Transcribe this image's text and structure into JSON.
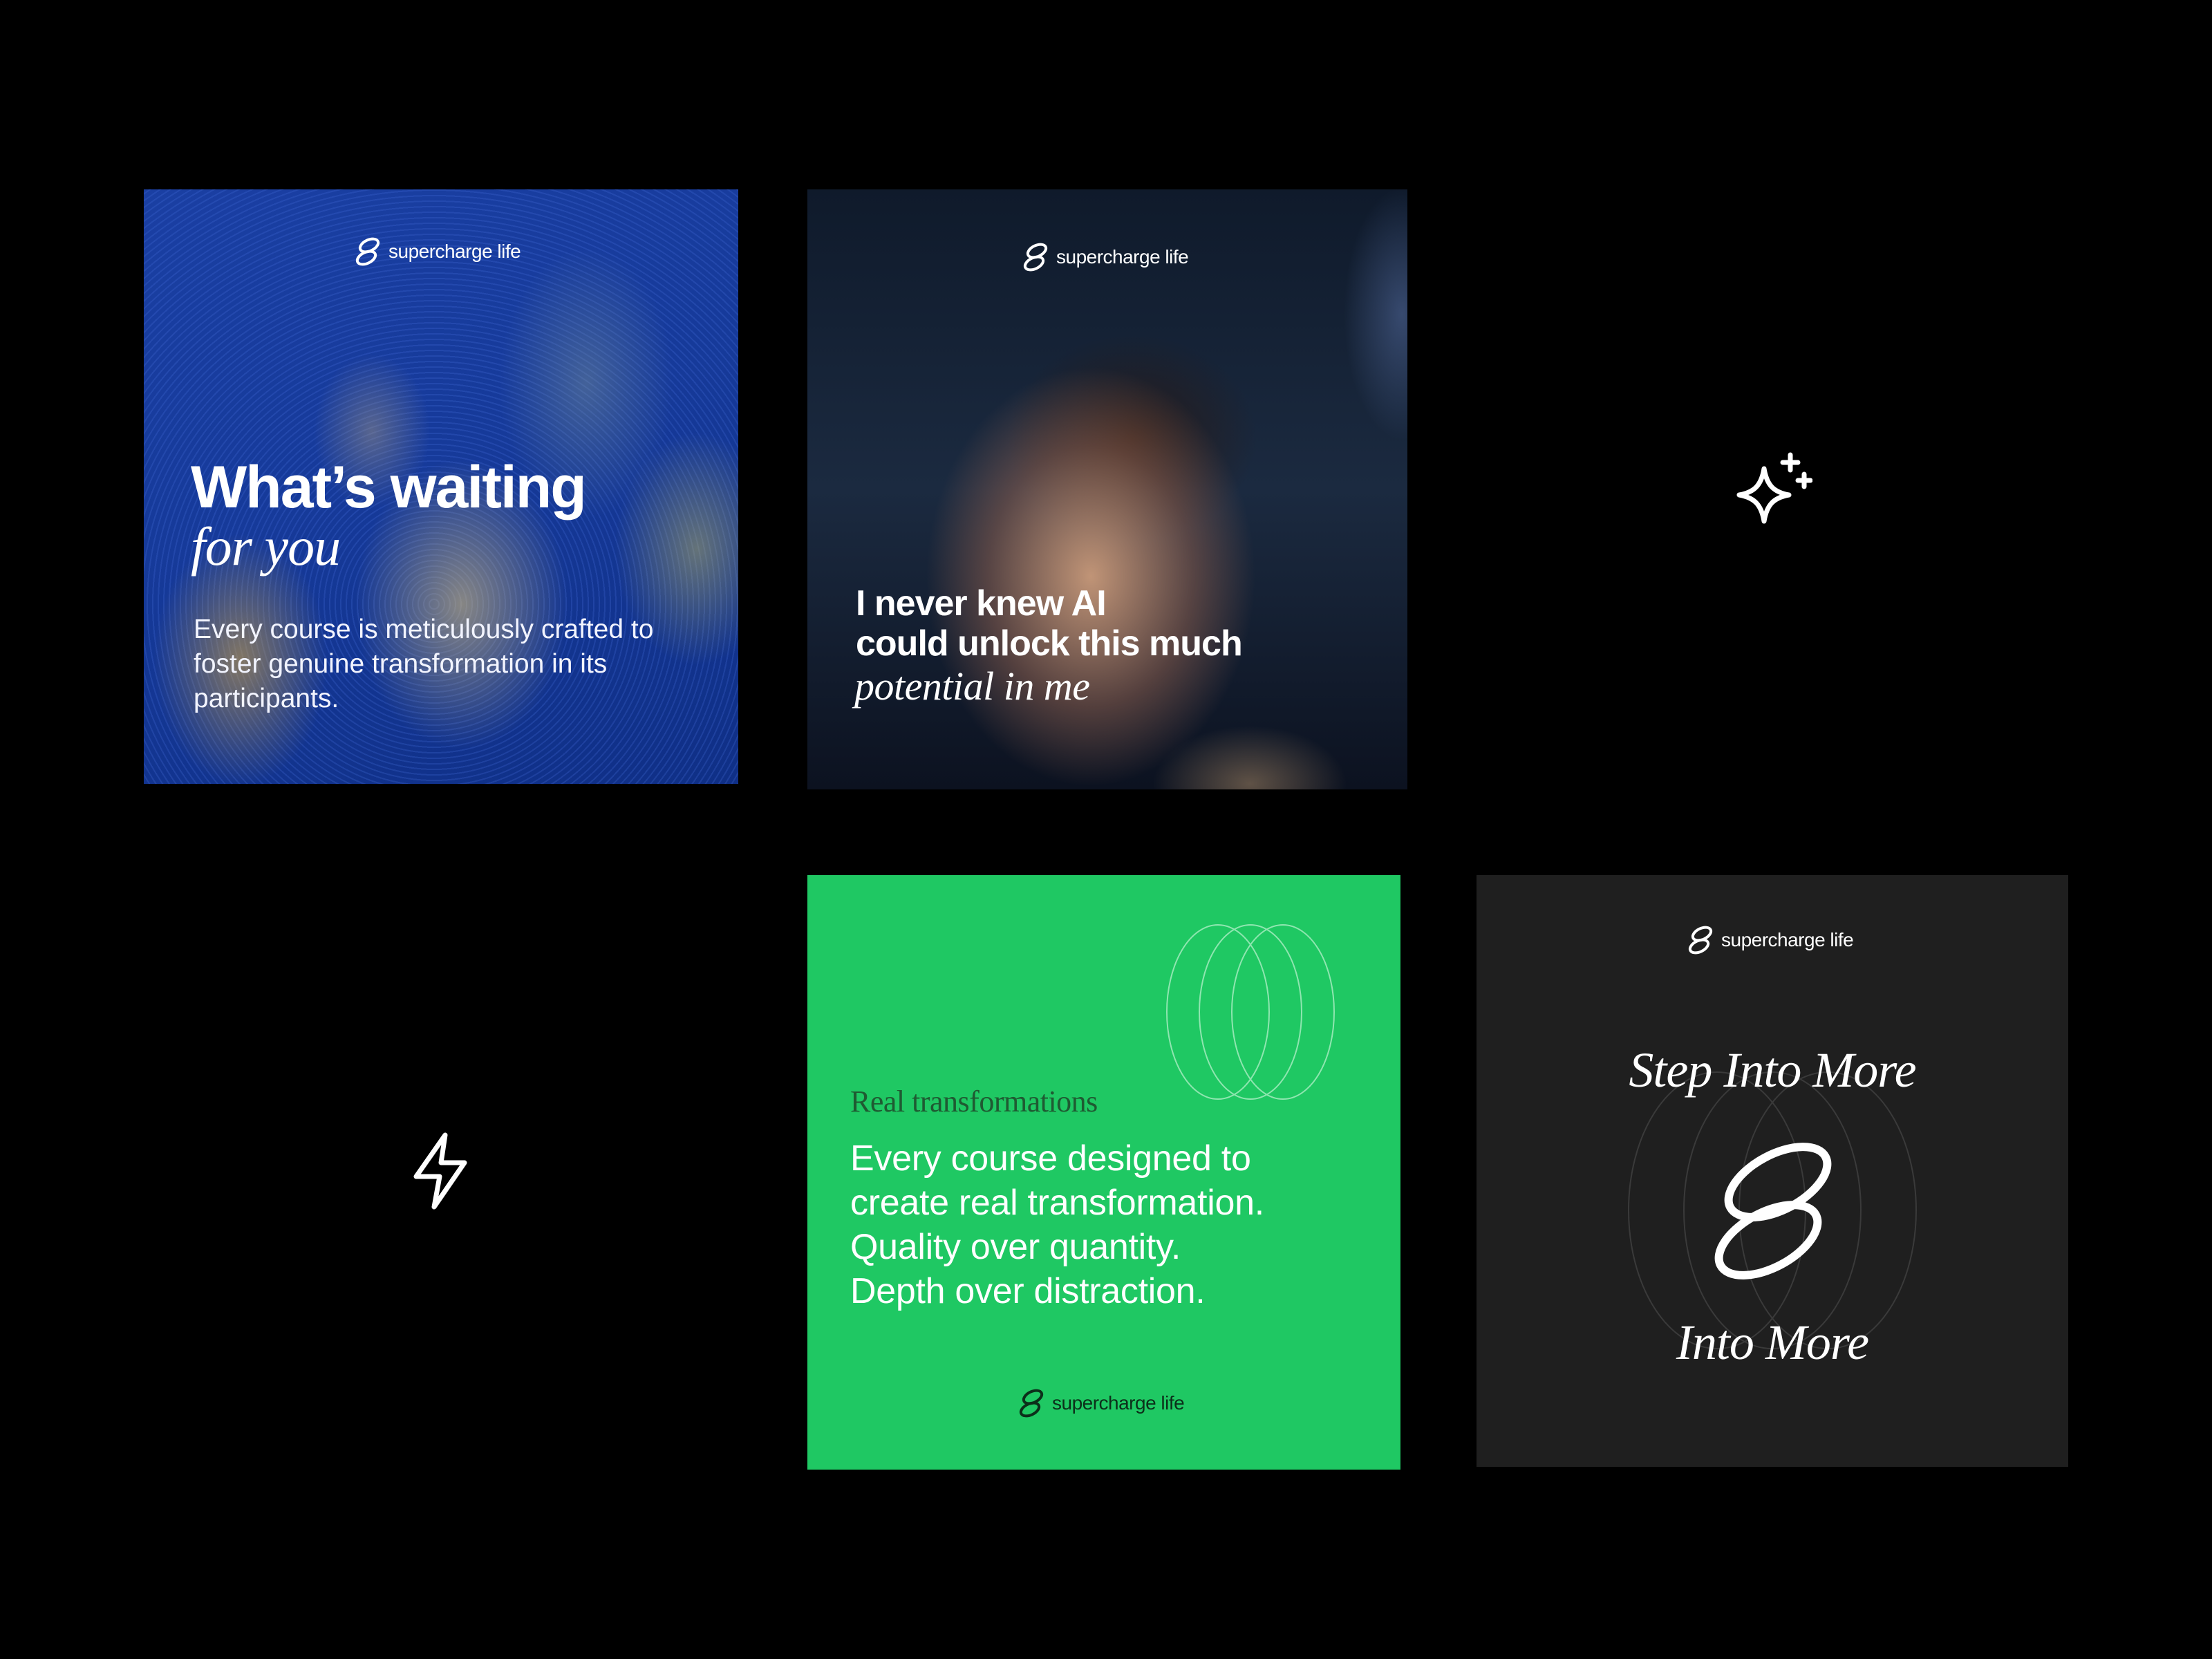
{
  "brand": {
    "name": "supercharge life"
  },
  "card_1": {
    "headline": "What’s waiting",
    "headline_italic": "for you",
    "body": "Every course is meticulously crafted to foster genuine transformation in its participants."
  },
  "card_2": {
    "quote_line_1": "I never knew AI",
    "quote_line_2": "could unlock this much",
    "quote_italic": "potential in me"
  },
  "card_4": {
    "label": "Real transformations",
    "body_line_1": "Every course designed to",
    "body_line_2": "create real transformation.",
    "body_line_3": "Quality over quantity.",
    "body_line_4": "Depth over distraction."
  },
  "card_5": {
    "title_top": "Step Into More",
    "title_bottom": "Into More"
  },
  "icons": {
    "sparkle": "sparkle-icon",
    "lightning": "lightning-bolt-icon",
    "brand_mark": "supercharge-s-logo-icon"
  },
  "colors": {
    "background": "#000000",
    "blue_card": "#163a9a",
    "green_card": "#1fc863",
    "dark_card": "#1f1f1f",
    "text_light": "#ffffff",
    "green_label": "#1f5a32"
  }
}
